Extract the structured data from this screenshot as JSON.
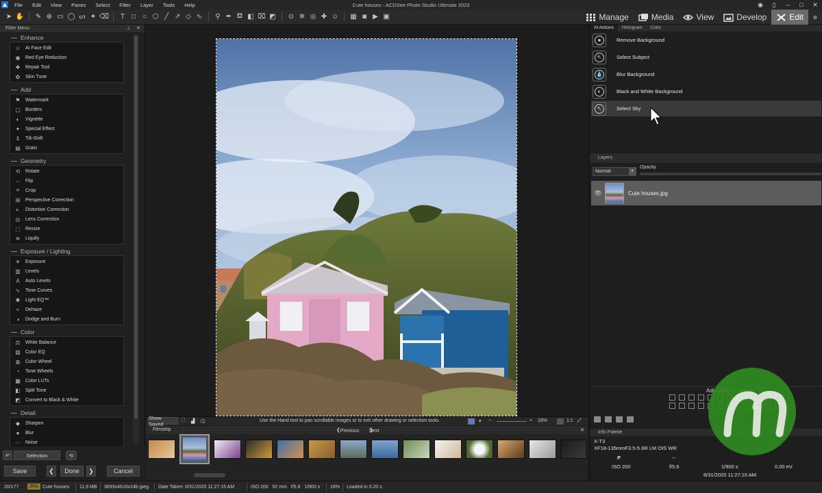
{
  "window": {
    "title": "Cute houses - ACDSee Photo Studio Ultimate 2023",
    "menu": [
      "File",
      "Edit",
      "View",
      "Panes",
      "Select",
      "Filter",
      "Layer",
      "Tools",
      "Help"
    ]
  },
  "modes": [
    {
      "label": "Manage",
      "icon": "grid-icon"
    },
    {
      "label": "Media",
      "icon": "media-icon"
    },
    {
      "label": "View",
      "icon": "eye-icon"
    },
    {
      "label": "Develop",
      "icon": "develop-icon"
    },
    {
      "label": "Edit",
      "icon": "edit-tools-icon",
      "active": true
    }
  ],
  "filter_menu": {
    "title": "Filter Menu",
    "groups": [
      {
        "title": "Enhance",
        "items": [
          "AI Face Edit",
          "Red Eye Reduction",
          "Repair Tool",
          "Skin Tune"
        ]
      },
      {
        "title": "Add",
        "items": [
          "Watermark",
          "Borders",
          "Vignette",
          "Special Effect",
          "Tilt-Shift",
          "Grain"
        ]
      },
      {
        "title": "Geometry",
        "items": [
          "Rotate",
          "Flip",
          "Crop",
          "Perspective Correction",
          "Distortion Correction",
          "Lens Correction",
          "Resize",
          "Liquify"
        ]
      },
      {
        "title": "Exposure / Lighting",
        "items": [
          "Exposure",
          "Levels",
          "Auto Levels",
          "Tone Curves",
          "Light EQ™",
          "Dehaze",
          "Dodge and Burn"
        ]
      },
      {
        "title": "Color",
        "items": [
          "White Balance",
          "Color EQ",
          "Color Wheel",
          "Tone Wheels",
          "Color LUTs",
          "Split Tone",
          "Convert to Black & White"
        ]
      },
      {
        "title": "Detail",
        "items": [
          "Sharpen",
          "Blur",
          "Noise"
        ]
      }
    ]
  },
  "bottom_left": {
    "selection": "Selection",
    "save": "Save",
    "done": "Done",
    "cancel": "Cancel"
  },
  "canvas": {
    "hint": "Use the Hand tool to pan scrollable images or to exit other drawing or selection tools.",
    "show_saved": "Show Saved",
    "zoom": "18%",
    "ratio": "1:1"
  },
  "filmstrip": {
    "title": "Filmstrip",
    "previous": "Previous",
    "next": "Next"
  },
  "right_panel": {
    "tabs": [
      "AI Actions",
      "Histogram",
      "Color"
    ],
    "ai_actions": [
      {
        "label": "Remove Background",
        "icon": "remove-background-icon"
      },
      {
        "label": "Select Subject",
        "icon": "select-subject-icon"
      },
      {
        "label": "Blur Background",
        "icon": "blur-background-icon"
      },
      {
        "label": "Black and White Background",
        "icon": "bw-background-icon"
      },
      {
        "label": "Select Sky",
        "icon": "select-sky-icon"
      }
    ],
    "layers": {
      "title": "Layers",
      "blend_mode": "Normal",
      "opacity_label": "Opacity",
      "layer_name": "Cute houses.jpg"
    },
    "adjustment_layers_title": "Adjustment Layers",
    "info_palette": {
      "title": "Info Palette",
      "camera": "X-T3",
      "lens": "XF18-135mmF3.5-5.6R LM OIS WR",
      "mode": "P",
      "iso": "ISO 200",
      "aperture": "f/5.6",
      "shutter": "1/900 s",
      "ev": "0.00 eV",
      "date": "8/31/2020 11:27:15 AM"
    }
  },
  "statusbar": {
    "position": "20/177",
    "format": "JPG",
    "name": "Cute houses",
    "size": "11.9 MB",
    "dimensions": "3693x4616x24b jpeg",
    "date_taken": "Date Taken: 8/31/2020 11:27:15 AM",
    "exposure": "ISO 200   52 mm   f/5.6   1/900 s",
    "zoom": "18%",
    "loaded": "Loaded in 0.20 s"
  },
  "colors": {
    "accent_active": "#6a6a6a",
    "watermark": "#2f8a21"
  }
}
